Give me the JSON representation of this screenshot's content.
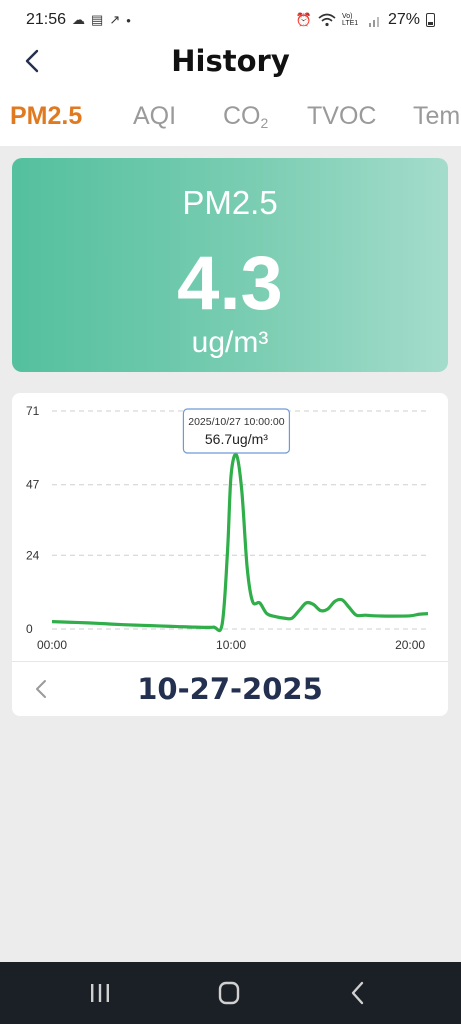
{
  "status_bar": {
    "time": "21:56",
    "left_icons": [
      "cloud-icon",
      "calendar-icon",
      "trend-icon",
      "dot-icon"
    ],
    "right_icons": [
      "alarm-icon",
      "wifi-icon",
      "volte-icon",
      "signal-icon"
    ],
    "volte_label": "Vo) LTE1",
    "battery_text": "27%"
  },
  "header": {
    "title": "History"
  },
  "tabs": [
    {
      "label": "PM2.5",
      "active": true
    },
    {
      "label": "AQI",
      "active": false
    },
    {
      "label": "CO",
      "sub": "2",
      "active": false
    },
    {
      "label": "TVOC",
      "active": false
    },
    {
      "label": "Tem",
      "active": false
    }
  ],
  "colors": {
    "accent": "#e07a20",
    "card_green": "#54c09e",
    "line": "#2fae4a",
    "date_text": "#24304f"
  },
  "hero": {
    "label": "PM2.5",
    "value": "4.3",
    "unit": "ug/m³"
  },
  "chart_data": {
    "type": "line",
    "ylim": [
      0,
      71
    ],
    "y_ticks": [
      "0",
      "24",
      "47",
      "71"
    ],
    "x_ticks": [
      "00:00",
      "10:00",
      "20:00"
    ],
    "xlim": [
      0,
      21
    ],
    "grid": true,
    "series": [
      {
        "x": [
          0,
          1,
          2,
          3,
          4,
          5,
          6,
          7,
          8,
          9,
          9.5,
          9.8,
          10,
          10.3,
          10.6,
          10.9,
          11.2,
          11.6,
          12,
          12.5,
          13,
          13.4,
          13.8,
          14.2,
          14.6,
          15,
          15.4,
          15.8,
          16.2,
          16.6,
          17,
          17.5,
          18,
          19,
          20,
          20.5,
          21
        ],
        "y": [
          2.4,
          2.2,
          2.0,
          1.7,
          1.4,
          1.2,
          1.0,
          0.8,
          0.6,
          0.6,
          1.5,
          25,
          50,
          56.7,
          45,
          20,
          9,
          8.5,
          5,
          4,
          3.5,
          3.5,
          6,
          8.5,
          8,
          6,
          6.5,
          9,
          9.5,
          7,
          4.5,
          4.5,
          4.3,
          4.2,
          4.3,
          4.8,
          5
        ]
      }
    ],
    "tooltip": {
      "time": "2025/10/27 10:00:00",
      "value": "56.7ug/m³"
    }
  },
  "date_nav": {
    "date": "10-27-2025"
  },
  "nav_bar": {
    "buttons": [
      "recents-button",
      "home-button",
      "back-button"
    ]
  }
}
